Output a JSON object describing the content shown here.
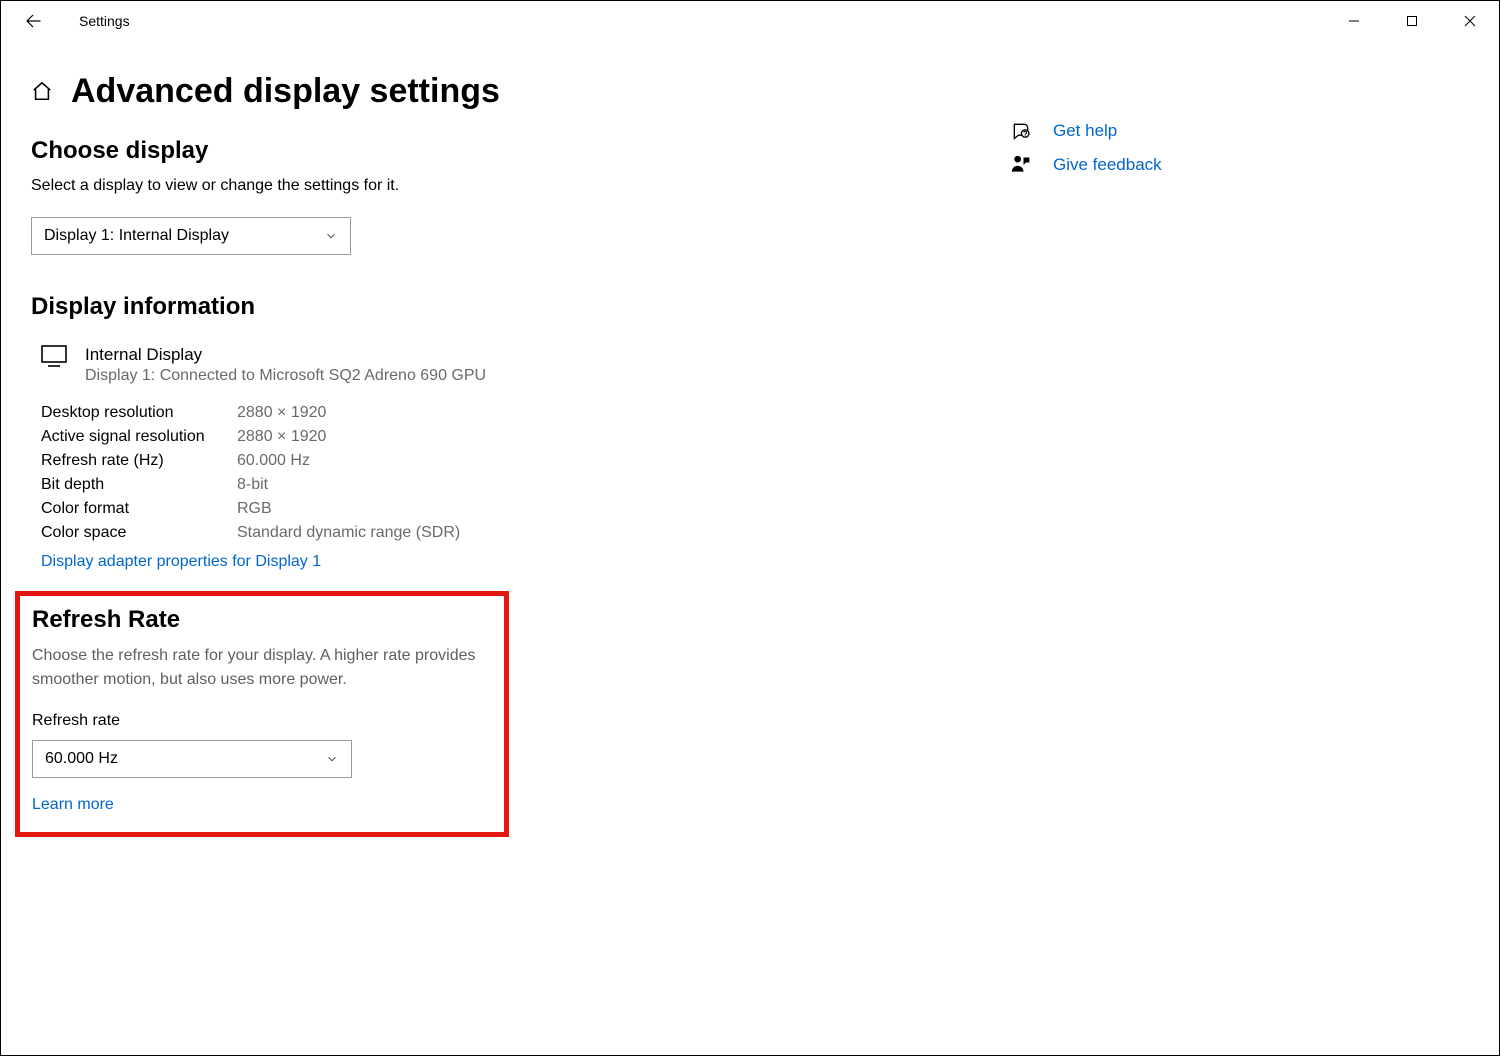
{
  "app_title": "Settings",
  "page_title": "Advanced display settings",
  "choose_display": {
    "heading": "Choose display",
    "subtext": "Select a display to view or change the settings for it.",
    "selected": "Display 1: Internal Display"
  },
  "display_info": {
    "heading": "Display information",
    "name": "Internal Display",
    "subname": "Display 1: Connected to Microsoft SQ2 Adreno 690 GPU",
    "rows": [
      {
        "k": "Desktop resolution",
        "v": "2880 × 1920"
      },
      {
        "k": "Active signal resolution",
        "v": "2880 × 1920"
      },
      {
        "k": "Refresh rate (Hz)",
        "v": "60.000 Hz"
      },
      {
        "k": "Bit depth",
        "v": "8-bit"
      },
      {
        "k": "Color format",
        "v": "RGB"
      },
      {
        "k": "Color space",
        "v": "Standard dynamic range (SDR)"
      }
    ],
    "adapter_link": "Display adapter properties for Display 1"
  },
  "refresh_rate": {
    "heading": "Refresh Rate",
    "desc": "Choose the refresh rate for your display. A higher rate provides smoother motion, but also uses more power.",
    "label": "Refresh rate",
    "selected": "60.000 Hz",
    "learn_more": "Learn more"
  },
  "side": {
    "get_help": "Get help",
    "give_feedback": "Give feedback"
  }
}
